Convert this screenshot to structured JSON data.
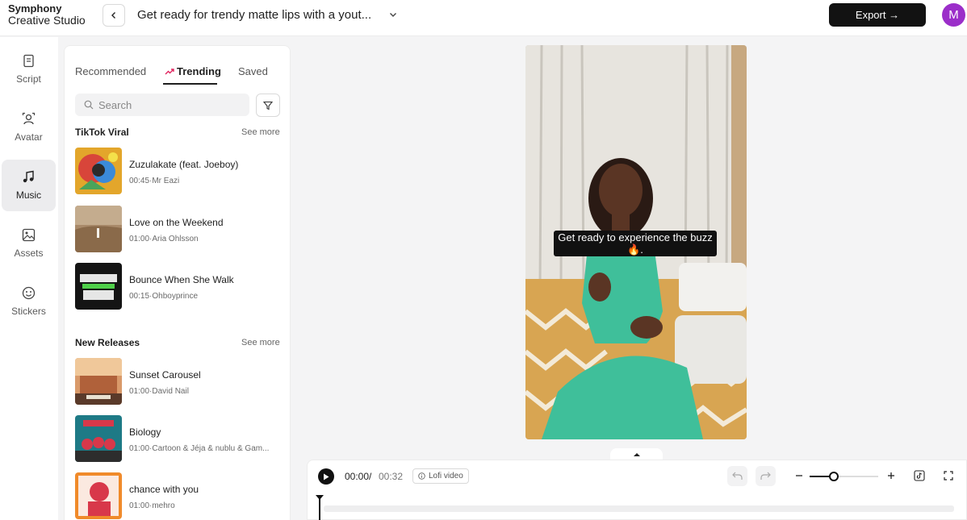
{
  "app": {
    "logo_line1": "Symphony",
    "logo_line2": "Creative Studio",
    "project_title": "Get ready for trendy matte lips with a yout...",
    "export_label": "Export →",
    "avatar_initial": "M",
    "avatar_color": "#9b2ec9"
  },
  "nav": {
    "items": [
      {
        "label": "Script",
        "icon": "script-icon"
      },
      {
        "label": "Avatar",
        "icon": "avatar-icon"
      },
      {
        "label": "Music",
        "icon": "music-icon",
        "active": true
      },
      {
        "label": "Assets",
        "icon": "image-icon"
      },
      {
        "label": "Stickers",
        "icon": "sticker-icon"
      }
    ]
  },
  "music_panel": {
    "tabs": [
      {
        "label": "Recommended"
      },
      {
        "label": "Trending",
        "active": true,
        "icon": "trending-icon"
      },
      {
        "label": "Saved"
      }
    ],
    "search_placeholder": "Search",
    "sections": [
      {
        "title": "TikTok Viral",
        "see_more": "See more",
        "tracks": [
          {
            "title": "Zuzulakate (feat. Joeboy)",
            "meta": "00:45·Mr Eazi"
          },
          {
            "title": "Love on the Weekend",
            "meta": "01:00·Aria Ohlsson"
          },
          {
            "title": "Bounce When She Walk",
            "meta": "00:15·Ohboyprince"
          }
        ]
      },
      {
        "title": "New Releases",
        "see_more": "See more",
        "tracks": [
          {
            "title": "Sunset Carousel",
            "meta": "01:00·David Nail"
          },
          {
            "title": "Biology",
            "meta": "01:00·Cartoon & Jéja & nublu & Gam..."
          },
          {
            "title": "chance with you",
            "meta": "01:00·mehro"
          }
        ]
      }
    ]
  },
  "preview": {
    "caption": "Get ready to experience the buzz🔥."
  },
  "timeline": {
    "current_time": "00:00",
    "separator": "/",
    "total_time": "00:32",
    "badge": "Lofi video",
    "zoom_level_fraction": 0.35
  }
}
